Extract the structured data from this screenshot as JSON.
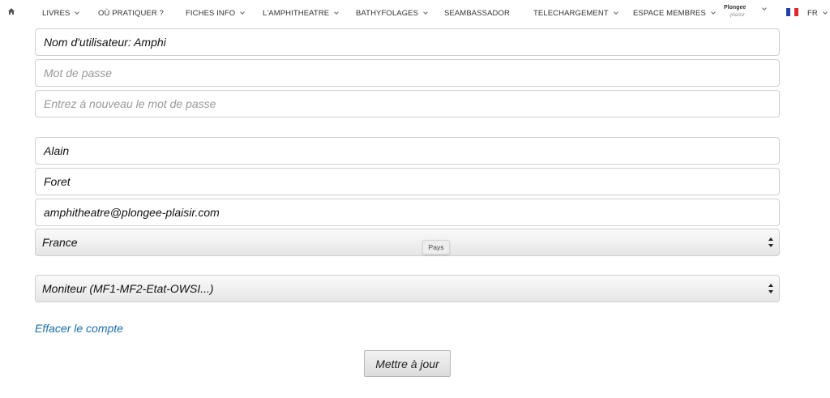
{
  "nav": {
    "home_icon": "home-icon",
    "items": [
      {
        "label": "LIVRES",
        "dropdown": true
      },
      {
        "label": "OÙ PRATIQUER ?",
        "dropdown": false
      },
      {
        "label": "FICHES INFO",
        "dropdown": true
      },
      {
        "label": "L'AMPHITHEATRE",
        "dropdown": true
      },
      {
        "label": "BATHYFOLAGES",
        "dropdown": true
      },
      {
        "label": "SEAMBASSADOR",
        "dropdown": false
      },
      {
        "label": "TELECHARGEMENT",
        "dropdown": true
      },
      {
        "label": "ESPACE MEMBRES",
        "dropdown": true
      }
    ],
    "logo_text": "Plongee",
    "logo_script": "plaisir",
    "language": "FR",
    "flag_colors": [
      "#1f3fa8",
      "#ffffff",
      "#e1262d"
    ]
  },
  "form": {
    "username": "Nom d'utilisateur: Amphi",
    "password_placeholder": "Mot de passe",
    "password_confirm_placeholder": "Entrez à nouveau le mot de passe",
    "first_name": "Alain",
    "last_name": "Foret",
    "email": "amphitheatre@plongee-plaisir.com",
    "country": "France",
    "country_tooltip": "Pays",
    "level": "Moniteur (MF1-MF2-Etat-OWSI...)",
    "delete_account_link": "Effacer le compte",
    "submit_label": "Mettre à jour"
  },
  "colors": {
    "link": "#1a6ea8",
    "placeholder": "#999999"
  }
}
